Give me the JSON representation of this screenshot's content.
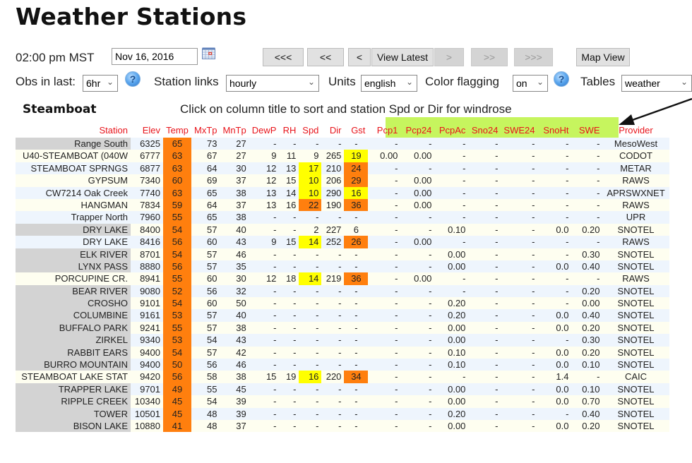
{
  "page": {
    "title": "Weather Stations"
  },
  "toolbar": {
    "time_label": "02:00 pm MST",
    "date_value": "Nov 16, 2016",
    "calendar_icon": "calendar-icon",
    "nav_buttons": [
      {
        "label": "<<<",
        "enabled": true
      },
      {
        "label": "<<",
        "enabled": true
      },
      {
        "label": "<",
        "enabled": true
      },
      {
        "label": "View Latest",
        "enabled": true
      },
      {
        "label": ">",
        "enabled": false
      },
      {
        "label": ">>",
        "enabled": false
      },
      {
        "label": ">>>",
        "enabled": false
      }
    ],
    "map_view_label": "Map View"
  },
  "filters": {
    "obs_label": "Obs in last:",
    "obs_value": "6hr",
    "help_icon": "help-icon",
    "station_links_label": "Station links",
    "station_links_value": "hourly",
    "units_label": "Units",
    "units_value": "english",
    "color_flagging_label": "Color flagging",
    "color_flagging_value": "on",
    "tables_label": "Tables",
    "tables_value": "weather"
  },
  "section": {
    "title": "Steamboat",
    "instructions": "Click on column title to sort and station Spd or Dir for windrose"
  },
  "colors": {
    "header_text": "#e8141b",
    "highlight_green": "#c6f55e",
    "flag_orange": "#ff7f0e",
    "flag_yellow": "#ffff00",
    "station_grey": "#d3d3d3"
  },
  "table": {
    "columns": [
      "Station",
      "Elev",
      "Temp",
      "MxTp",
      "MnTp",
      "DewP",
      "RH",
      "Spd",
      "Dir",
      "Gst",
      "Pcp1",
      "Pcp24",
      "PcpAc",
      "Sno24",
      "SWE24",
      "SnoHt",
      "SWE",
      "Provider"
    ],
    "rows": [
      {
        "station": "Range South",
        "grey": true,
        "cells": [
          "6325",
          "65",
          "73",
          "27",
          "-",
          "-",
          "-",
          "-",
          "-",
          "-",
          "-",
          "-",
          "-",
          "-",
          "-",
          "-",
          "MesoWest"
        ],
        "flags": {
          "temp": "orange"
        }
      },
      {
        "station": "U40-STEAMBOAT (040W",
        "grey": false,
        "cells": [
          "6777",
          "63",
          "67",
          "27",
          "9",
          "11",
          "9",
          "265",
          "19",
          "0.00",
          "0.00",
          "-",
          "-",
          "-",
          "-",
          "-",
          "CODOT"
        ],
        "flags": {
          "temp": "orange",
          "gst": "yellow"
        }
      },
      {
        "station": "STEAMBOAT SPRNGS",
        "grey": false,
        "cells": [
          "6877",
          "63",
          "64",
          "30",
          "12",
          "13",
          "17",
          "210",
          "24",
          "-",
          "-",
          "-",
          "-",
          "-",
          "-",
          "-",
          "METAR"
        ],
        "flags": {
          "temp": "orange",
          "spd": "yellow",
          "gst": "orange"
        }
      },
      {
        "station": "GYPSUM",
        "grey": false,
        "cells": [
          "7340",
          "60",
          "69",
          "37",
          "12",
          "15",
          "10",
          "206",
          "29",
          "-",
          "0.00",
          "-",
          "-",
          "-",
          "-",
          "-",
          "RAWS"
        ],
        "flags": {
          "temp": "orange",
          "spd": "yellow",
          "gst": "orange"
        }
      },
      {
        "station": "CW7214 Oak Creek",
        "grey": false,
        "cells": [
          "7740",
          "63",
          "65",
          "38",
          "13",
          "14",
          "10",
          "290",
          "16",
          "-",
          "0.00",
          "-",
          "-",
          "-",
          "-",
          "-",
          "APRSWXNET"
        ],
        "flags": {
          "temp": "orange",
          "spd": "yellow",
          "gst": "yellow"
        }
      },
      {
        "station": "HANGMAN",
        "grey": false,
        "cells": [
          "7834",
          "59",
          "64",
          "37",
          "13",
          "16",
          "22",
          "190",
          "36",
          "-",
          "0.00",
          "-",
          "-",
          "-",
          "-",
          "-",
          "RAWS"
        ],
        "flags": {
          "temp": "orange",
          "spd": "orange",
          "gst": "orange"
        }
      },
      {
        "station": "Trapper North",
        "grey": false,
        "cells": [
          "7960",
          "55",
          "65",
          "38",
          "-",
          "-",
          "-",
          "-",
          "-",
          "-",
          "-",
          "-",
          "-",
          "-",
          "-",
          "-",
          "UPR"
        ],
        "flags": {
          "temp": "orange"
        }
      },
      {
        "station": "DRY LAKE",
        "grey": true,
        "cells": [
          "8400",
          "54",
          "57",
          "40",
          "-",
          "-",
          "2",
          "227",
          "6",
          "-",
          "-",
          "0.10",
          "-",
          "-",
          "0.0",
          "0.20",
          "SNOTEL"
        ],
        "flags": {
          "temp": "orange"
        }
      },
      {
        "station": "DRY LAKE",
        "grey": false,
        "cells": [
          "8416",
          "56",
          "60",
          "43",
          "9",
          "15",
          "14",
          "252",
          "26",
          "-",
          "0.00",
          "-",
          "-",
          "-",
          "-",
          "-",
          "RAWS"
        ],
        "flags": {
          "temp": "orange",
          "spd": "yellow",
          "gst": "orange"
        }
      },
      {
        "station": "ELK RIVER",
        "grey": true,
        "cells": [
          "8701",
          "54",
          "57",
          "46",
          "-",
          "-",
          "-",
          "-",
          "-",
          "-",
          "-",
          "0.00",
          "-",
          "-",
          "-",
          "0.30",
          "SNOTEL"
        ],
        "flags": {
          "temp": "orange"
        }
      },
      {
        "station": "LYNX PASS",
        "grey": true,
        "cells": [
          "8880",
          "56",
          "57",
          "35",
          "-",
          "-",
          "-",
          "-",
          "-",
          "-",
          "-",
          "0.00",
          "-",
          "-",
          "0.0",
          "0.40",
          "SNOTEL"
        ],
        "flags": {
          "temp": "orange"
        }
      },
      {
        "station": "PORCUPINE CR.",
        "grey": false,
        "cells": [
          "8941",
          "55",
          "60",
          "30",
          "12",
          "18",
          "14",
          "219",
          "36",
          "-",
          "0.00",
          "-",
          "-",
          "-",
          "-",
          "-",
          "RAWS"
        ],
        "flags": {
          "temp": "orange",
          "spd": "yellow",
          "gst": "orange"
        }
      },
      {
        "station": "BEAR RIVER",
        "grey": true,
        "cells": [
          "9080",
          "52",
          "56",
          "32",
          "-",
          "-",
          "-",
          "-",
          "-",
          "-",
          "-",
          "-",
          "-",
          "-",
          "-",
          "0.20",
          "SNOTEL"
        ],
        "flags": {
          "temp": "orange"
        }
      },
      {
        "station": "CROSHO",
        "grey": true,
        "cells": [
          "9101",
          "54",
          "60",
          "50",
          "-",
          "-",
          "-",
          "-",
          "-",
          "-",
          "-",
          "0.20",
          "-",
          "-",
          "-",
          "0.00",
          "SNOTEL"
        ],
        "flags": {
          "temp": "orange"
        }
      },
      {
        "station": "COLUMBINE",
        "grey": true,
        "cells": [
          "9161",
          "53",
          "57",
          "40",
          "-",
          "-",
          "-",
          "-",
          "-",
          "-",
          "-",
          "0.20",
          "-",
          "-",
          "0.0",
          "0.40",
          "SNOTEL"
        ],
        "flags": {
          "temp": "orange"
        }
      },
      {
        "station": "BUFFALO PARK",
        "grey": true,
        "cells": [
          "9241",
          "55",
          "57",
          "38",
          "-",
          "-",
          "-",
          "-",
          "-",
          "-",
          "-",
          "0.00",
          "-",
          "-",
          "0.0",
          "0.20",
          "SNOTEL"
        ],
        "flags": {
          "temp": "orange"
        }
      },
      {
        "station": "ZIRKEL",
        "grey": true,
        "cells": [
          "9340",
          "53",
          "54",
          "43",
          "-",
          "-",
          "-",
          "-",
          "-",
          "-",
          "-",
          "0.00",
          "-",
          "-",
          "-",
          "0.30",
          "SNOTEL"
        ],
        "flags": {
          "temp": "orange"
        }
      },
      {
        "station": "RABBIT EARS",
        "grey": true,
        "cells": [
          "9400",
          "54",
          "57",
          "42",
          "-",
          "-",
          "-",
          "-",
          "-",
          "-",
          "-",
          "0.10",
          "-",
          "-",
          "0.0",
          "0.20",
          "SNOTEL"
        ],
        "flags": {
          "temp": "orange"
        }
      },
      {
        "station": "BURRO MOUNTAIN",
        "grey": true,
        "cells": [
          "9400",
          "50",
          "56",
          "46",
          "-",
          "-",
          "-",
          "-",
          "-",
          "-",
          "-",
          "0.10",
          "-",
          "-",
          "0.0",
          "0.10",
          "SNOTEL"
        ],
        "flags": {
          "temp": "orange"
        }
      },
      {
        "station": "STEAMBOAT LAKE STAT",
        "grey": false,
        "cells": [
          "9420",
          "56",
          "58",
          "38",
          "15",
          "19",
          "16",
          "220",
          "34",
          "-",
          "-",
          "-",
          "-",
          "-",
          "1.4",
          "-",
          "CAIC"
        ],
        "flags": {
          "temp": "orange",
          "spd": "yellow",
          "gst": "orange"
        }
      },
      {
        "station": "TRAPPER LAKE",
        "grey": true,
        "cells": [
          "9701",
          "49",
          "55",
          "45",
          "-",
          "-",
          "-",
          "-",
          "-",
          "-",
          "-",
          "0.00",
          "-",
          "-",
          "0.0",
          "0.10",
          "SNOTEL"
        ],
        "flags": {
          "temp": "orange"
        }
      },
      {
        "station": "RIPPLE CREEK",
        "grey": true,
        "cells": [
          "10340",
          "45",
          "54",
          "39",
          "-",
          "-",
          "-",
          "-",
          "-",
          "-",
          "-",
          "0.00",
          "-",
          "-",
          "0.0",
          "0.70",
          "SNOTEL"
        ],
        "flags": {
          "temp": "orange"
        }
      },
      {
        "station": "TOWER",
        "grey": true,
        "cells": [
          "10501",
          "45",
          "48",
          "39",
          "-",
          "-",
          "-",
          "-",
          "-",
          "-",
          "-",
          "0.20",
          "-",
          "-",
          "-",
          "0.40",
          "SNOTEL"
        ],
        "flags": {
          "temp": "orange"
        }
      },
      {
        "station": "BISON LAKE",
        "grey": true,
        "cells": [
          "10880",
          "41",
          "48",
          "37",
          "-",
          "-",
          "-",
          "-",
          "-",
          "-",
          "-",
          "0.00",
          "-",
          "-",
          "0.0",
          "0.20",
          "SNOTEL"
        ],
        "flags": {
          "temp": "orange"
        }
      }
    ]
  }
}
